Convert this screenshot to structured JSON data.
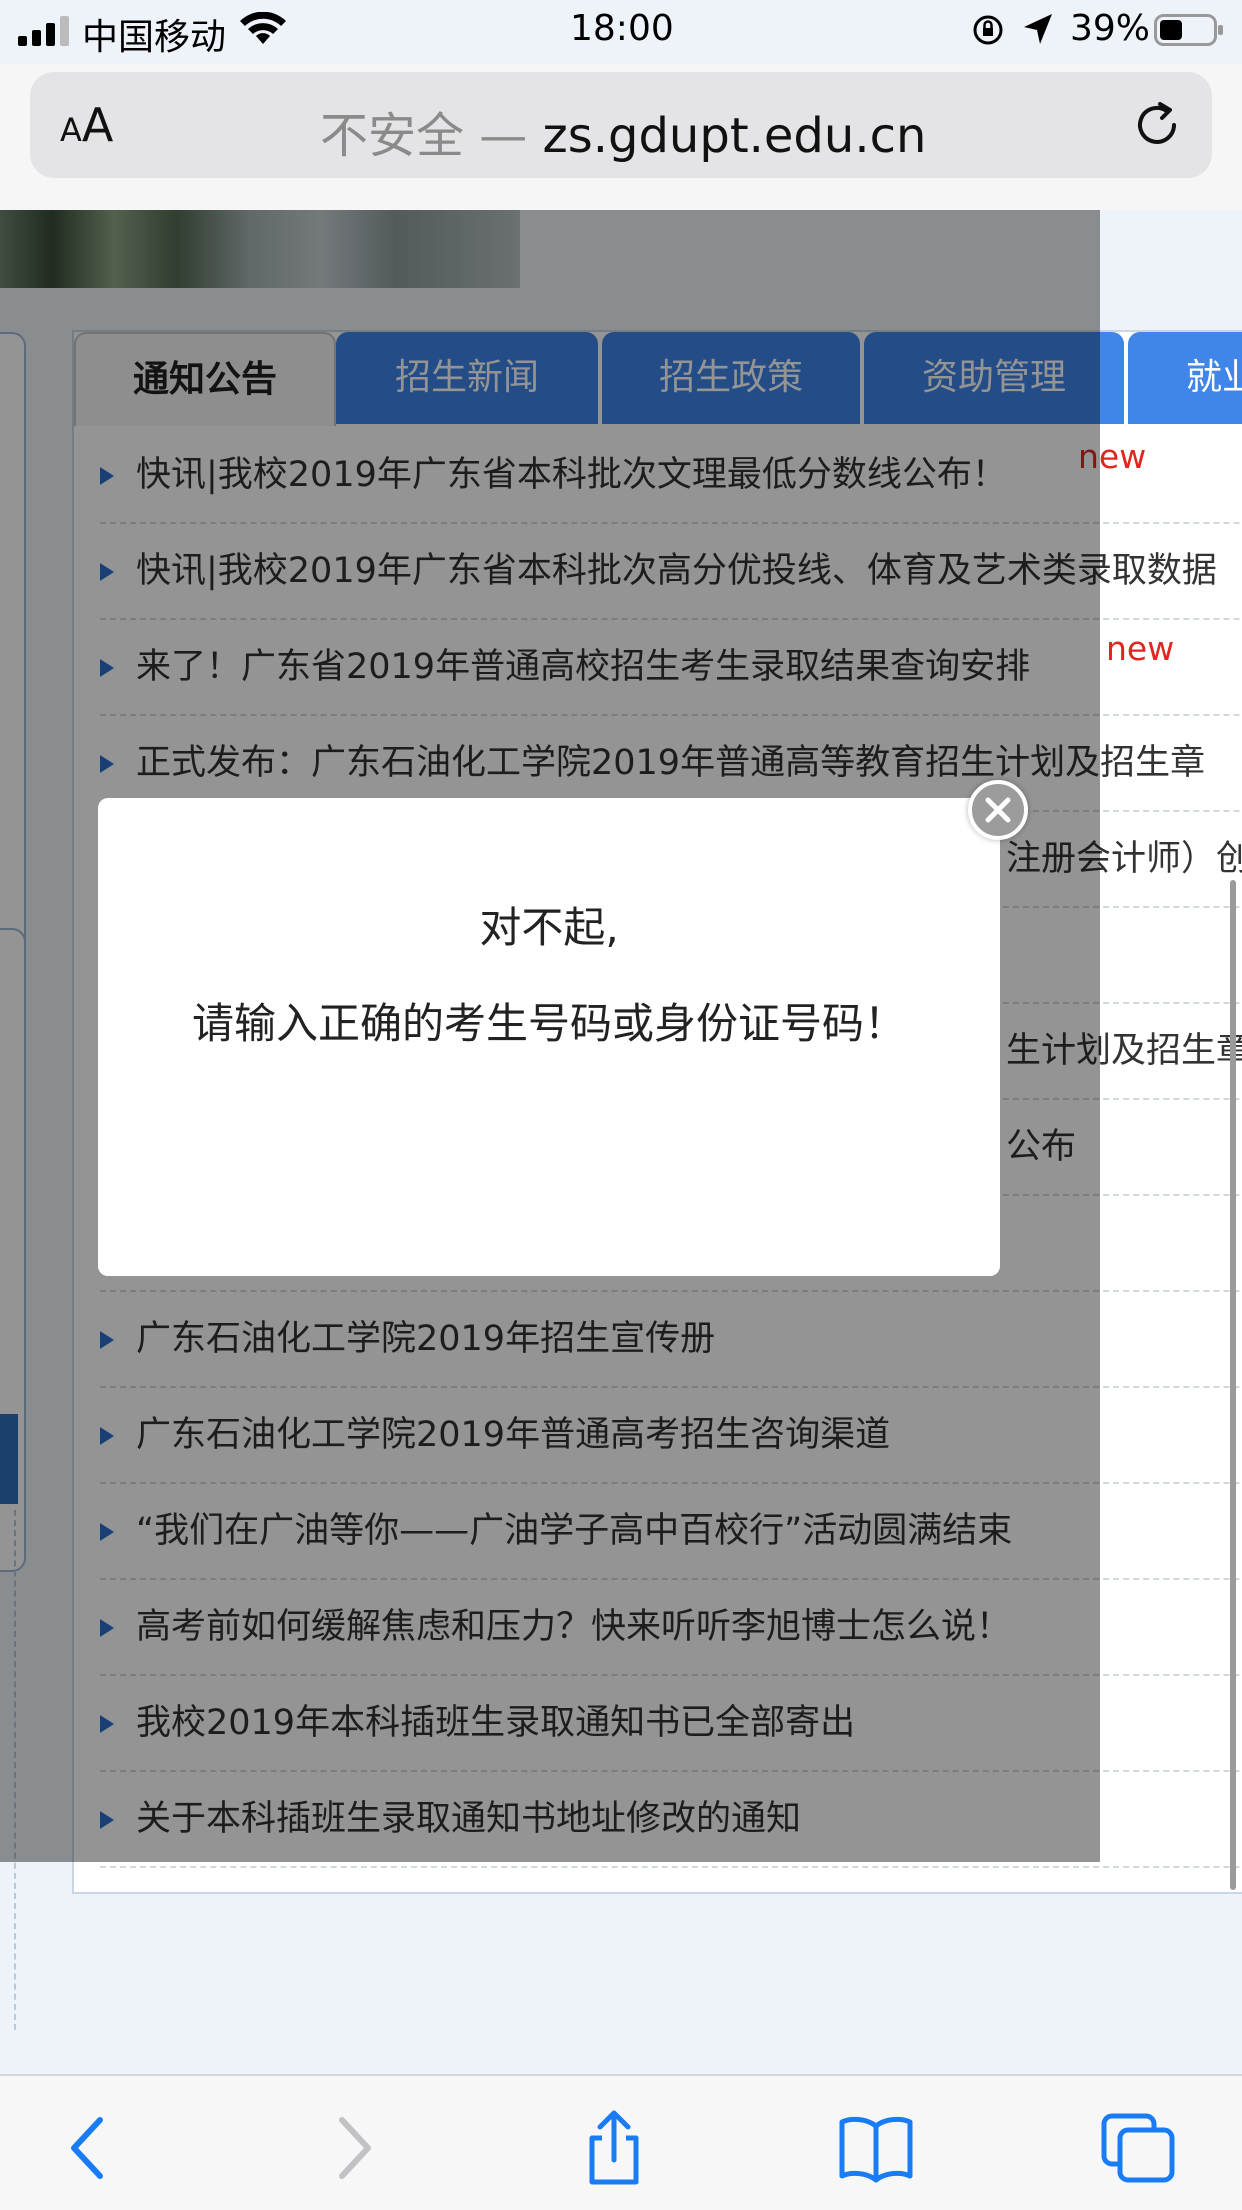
{
  "status_bar": {
    "carrier": "中国移动",
    "time": "18:00",
    "battery": "39%"
  },
  "browser": {
    "text_size_label": "AA",
    "insecure_label": "不安全 —",
    "domain": "zs.gdupt.edu.cn"
  },
  "tabs": [
    {
      "label": "通知公告",
      "active": true
    },
    {
      "label": "招生新闻",
      "active": false
    },
    {
      "label": "招生政策",
      "active": false
    },
    {
      "label": "资助管理",
      "active": false
    },
    {
      "label": "就业",
      "active": false
    }
  ],
  "news": [
    {
      "title": "快讯|我校2019年广东省本科批次文理最低分数线公布！",
      "badge": "new"
    },
    {
      "title": "快讯|我校2019年广东省本科批次高分优投线、体育及艺术类录取数据",
      "badge": ""
    },
    {
      "title": "来了！广东省2019年普通高校招生考生录取结果查询安排",
      "badge": "new"
    },
    {
      "title": "正式发布：广东石油化工学院2019年普通高等教育招生计划及招生章",
      "badge": ""
    },
    {
      "title": "注册会计师）创",
      "badge": ""
    },
    {
      "title": "",
      "badge": ""
    },
    {
      "title": "生计划及招生章",
      "badge": ""
    },
    {
      "title": "公布",
      "badge": ""
    },
    {
      "title": "",
      "badge": ""
    },
    {
      "title": "广东石油化工学院2019年招生宣传册",
      "badge": ""
    },
    {
      "title": "广东石油化工学院2019年普通高考招生咨询渠道",
      "badge": ""
    },
    {
      "title": "“我们在广油等你——广油学子高中百校行”活动圆满结束",
      "badge": ""
    },
    {
      "title": "高考前如何缓解焦虑和压力？快来听听李旭博士怎么说！",
      "badge": ""
    },
    {
      "title": "我校2019年本科插班生录取通知书已全部寄出",
      "badge": ""
    },
    {
      "title": "关于本科插班生录取通知书地址修改的通知",
      "badge": ""
    }
  ],
  "modal": {
    "line1": "对不起,",
    "line2": "请输入正确的考生号码或身份证号码！"
  },
  "toolbar_icons": [
    "back-icon",
    "forward-icon",
    "share-icon",
    "bookmarks-icon",
    "tabs-icon"
  ],
  "colors": {
    "tab_blue": "#3f86e8",
    "new_badge": "#e0261f",
    "ios_blue": "#1a7cf5"
  }
}
